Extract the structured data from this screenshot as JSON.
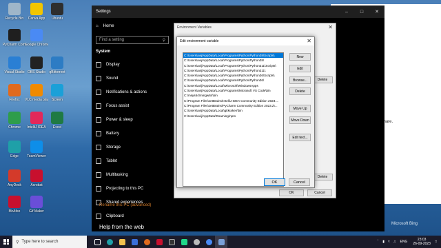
{
  "desktop_icons": [
    {
      "label": "Recycle Bin",
      "color": "#9fb6c9"
    },
    {
      "label": "Canva App",
      "color": "#f2c500"
    },
    {
      "label": "Ubuntu",
      "color": "#2e2e2e"
    },
    {
      "label": "PyCharm Commun..",
      "color": "#1f1f1f"
    },
    {
      "label": "Google Chrome",
      "color": "#4a8af4"
    },
    {
      "label": "Visual Studio",
      "color": "#2a7fd4"
    },
    {
      "label": "OBS Studio",
      "color": "#222222"
    },
    {
      "label": "qBittorrent",
      "color": "#2d7cc4"
    },
    {
      "label": "Firefox",
      "color": "#e06a1e"
    },
    {
      "label": "VLC media player",
      "color": "#f08a00"
    },
    {
      "label": "Screen",
      "color": "#1aa0d8"
    },
    {
      "label": "Chrome",
      "color": "#2e9d4b"
    },
    {
      "label": "IntelliJ IDEA",
      "color": "#e3285a"
    },
    {
      "label": "Excel",
      "color": "#1f7a43"
    },
    {
      "label": "Edge",
      "color": "#1fa0a8"
    },
    {
      "label": "TeamViewer",
      "color": "#0e8ee9"
    },
    {
      "label": "AnyDesk",
      "color": "#d43a2a"
    },
    {
      "label": "Acrobat",
      "color": "#c8102e"
    },
    {
      "label": "McAfee",
      "color": "#c8102e"
    },
    {
      "label": "Gif Maker",
      "color": "#6a4ed8"
    }
  ],
  "settings": {
    "title": "Settings",
    "home": "Home",
    "search_placeholder": "Find a setting",
    "section": "System",
    "items": [
      {
        "label": "Display",
        "icon": "display-icon"
      },
      {
        "label": "Sound",
        "icon": "sound-icon"
      },
      {
        "label": "Notifications & actions",
        "icon": "notifications-icon"
      },
      {
        "label": "Focus assist",
        "icon": "focus-assist-icon"
      },
      {
        "label": "Power & sleep",
        "icon": "power-icon"
      },
      {
        "label": "Battery",
        "icon": "battery-icon"
      },
      {
        "label": "Storage",
        "icon": "storage-icon"
      },
      {
        "label": "Tablet",
        "icon": "tablet-icon"
      },
      {
        "label": "Multitasking",
        "icon": "multitasking-icon"
      },
      {
        "label": "Projecting to this PC",
        "icon": "projecting-icon"
      },
      {
        "label": "Shared experiences",
        "icon": "shared-icon"
      },
      {
        "label": "Clipboard",
        "icon": "clipboard-icon"
      }
    ],
    "rename_link": "Rename this PC (advanced)",
    "help_heading": "Help from the web",
    "bg_text": "so it's easier to share."
  },
  "env_vars": {
    "title": "Environment Variables",
    "buttons": {
      "delete_1": "Delete",
      "delete_2": "Delete",
      "ok": "OK",
      "cancel": "Cancel"
    }
  },
  "edit_dialog": {
    "title": "Edit environment variable",
    "paths": [
      "C:\\Users\\avij\\AppData\\Local\\Programs\\Python\\Python38\\Scripts\\",
      "C:\\Users\\avij\\AppData\\Local\\Programs\\Python\\Python38\\",
      "C:\\Users\\avij\\AppData\\Local\\Programs\\Python\\Python311\\Scripts\\",
      "C:\\Users\\avij\\AppData\\Local\\Programs\\Python\\Python311\\",
      "C:\\Users\\avij\\AppData\\Local\\Programs\\Python\\Python36\\Scripts\\",
      "C:\\Users\\avij\\AppData\\Local\\Programs\\Python\\Python36\\",
      "C:\\Users\\avij\\AppData\\Local\\Microsoft\\WindowsApps",
      "C:\\Users\\avij\\AppData\\Local\\Programs\\Microsoft VS Code\\bin",
      "C:\\msys64\\mingw64\\bin",
      "C:\\Program Files\\JetBrains\\IntelliJ IDEA Community Edition 2023....",
      "C:\\Program Files\\JetBrains\\PyCharm Community Edition 2023.2\\...",
      "C:\\Users\\avij\\AppData\\Local\\gitkraken\\bin",
      "C:\\Users\\avij\\AppData\\Roaming\\npm"
    ],
    "selected_index": 0,
    "buttons": {
      "new": "New",
      "edit": "Edit",
      "browse": "Browse...",
      "delete": "Delete",
      "move_up": "Move Up",
      "move_down": "Move Down",
      "edit_text": "Edit text...",
      "ok": "OK",
      "cancel": "Cancel"
    }
  },
  "taskbar": {
    "search_placeholder": "Type here to search",
    "language": "ENG",
    "time": "23:03",
    "date": "26-09-2023",
    "watermark": "Microsoft Bing"
  }
}
